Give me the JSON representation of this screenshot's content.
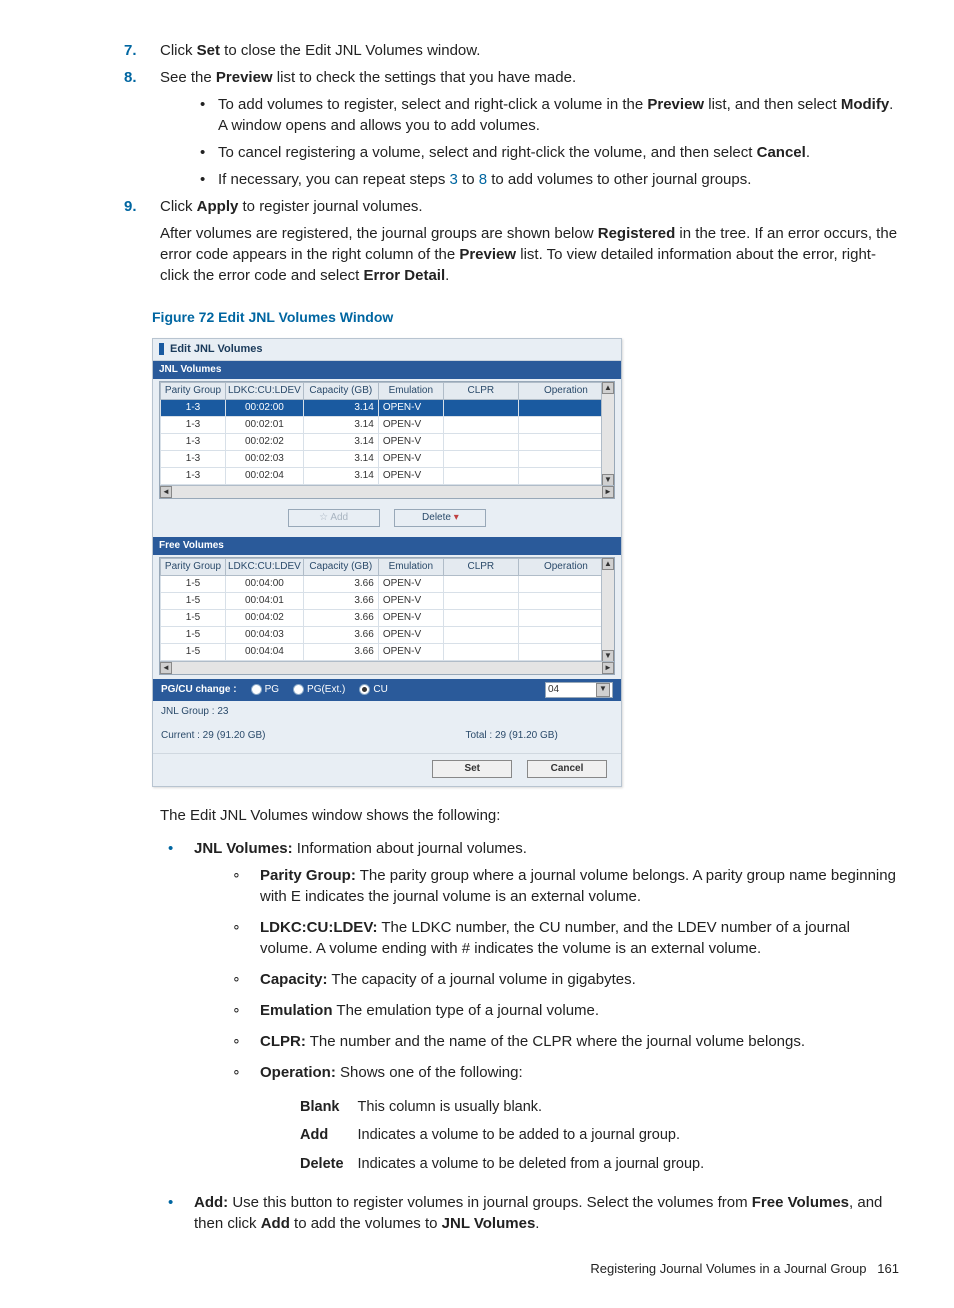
{
  "steps": {
    "s7_num": "7.",
    "s7_a": "Click ",
    "s7_b": "Set",
    "s7_c": " to close the Edit JNL Volumes window.",
    "s8_num": "8.",
    "s8_a": "See the ",
    "s8_b": "Preview",
    "s8_c": " list to check the settings that you have made.",
    "s8_b1_a": "To add volumes to register, select and right-click a volume in the ",
    "s8_b1_b": "Preview",
    "s8_b1_c": " list, and then select ",
    "s8_b1_d": "Modify",
    "s8_b1_e": ". A window opens and allows you to add volumes.",
    "s8_b2_a": "To cancel registering a volume, select and right-click the volume, and then select ",
    "s8_b2_b": "Cancel",
    "s8_b2_c": ".",
    "s8_b3_a": "If necessary, you can repeat steps ",
    "s8_b3_n1": "3",
    "s8_b3_b": " to ",
    "s8_b3_n2": "8",
    "s8_b3_c": " to add volumes to other journal groups.",
    "s9_num": "9.",
    "s9_a": "Click ",
    "s9_b": "Apply",
    "s9_c": " to register journal volumes.",
    "s9_p_a": "After volumes are registered, the journal groups are shown below ",
    "s9_p_b": "Registered",
    "s9_p_c": " in the tree. If an error occurs, the error code appears in the right column of the ",
    "s9_p_d": "Preview",
    "s9_p_e": " list. To view detailed information about the error, right-click the error code and select ",
    "s9_p_f": "Error Detail",
    "s9_p_g": "."
  },
  "figure_caption": "Figure 72 Edit JNL Volumes Window",
  "win": {
    "title": "Edit JNL Volumes",
    "sec_jnl": "JNL Volumes",
    "sec_free": "Free Volumes",
    "headers": [
      "Parity Group",
      "LDKC:CU:LDEV",
      "Capacity (GB)",
      "Emulation",
      "CLPR",
      "Operation"
    ],
    "jnl_rows": [
      {
        "pg": "1-3",
        "ldev": "00:02:00",
        "cap": "3.14",
        "emu": "OPEN-V",
        "clpr": "",
        "op": ""
      },
      {
        "pg": "1-3",
        "ldev": "00:02:01",
        "cap": "3.14",
        "emu": "OPEN-V",
        "clpr": "",
        "op": ""
      },
      {
        "pg": "1-3",
        "ldev": "00:02:02",
        "cap": "3.14",
        "emu": "OPEN-V",
        "clpr": "",
        "op": ""
      },
      {
        "pg": "1-3",
        "ldev": "00:02:03",
        "cap": "3.14",
        "emu": "OPEN-V",
        "clpr": "",
        "op": ""
      },
      {
        "pg": "1-3",
        "ldev": "00:02:04",
        "cap": "3.14",
        "emu": "OPEN-V",
        "clpr": "",
        "op": ""
      }
    ],
    "free_rows": [
      {
        "pg": "1-5",
        "ldev": "00:04:00",
        "cap": "3.66",
        "emu": "OPEN-V",
        "clpr": "",
        "op": ""
      },
      {
        "pg": "1-5",
        "ldev": "00:04:01",
        "cap": "3.66",
        "emu": "OPEN-V",
        "clpr": "",
        "op": ""
      },
      {
        "pg": "1-5",
        "ldev": "00:04:02",
        "cap": "3.66",
        "emu": "OPEN-V",
        "clpr": "",
        "op": ""
      },
      {
        "pg": "1-5",
        "ldev": "00:04:03",
        "cap": "3.66",
        "emu": "OPEN-V",
        "clpr": "",
        "op": ""
      },
      {
        "pg": "1-5",
        "ldev": "00:04:04",
        "cap": "3.66",
        "emu": "OPEN-V",
        "clpr": "",
        "op": ""
      }
    ],
    "btn_add": "Add",
    "btn_delete": "Delete",
    "pgcu_label": "PG/CU change :",
    "radio_pg": "PG",
    "radio_pgext": "PG(Ext.)",
    "radio_cu": "CU",
    "combo_val": "04",
    "jnl_group": "JNL Group : 23",
    "current": "Current : 29 (91.20 GB)",
    "total": "Total : 29 (91.20 GB)",
    "btn_set": "Set",
    "btn_cancel": "Cancel"
  },
  "after_fig": "The Edit JNL Volumes window shows the following:",
  "jnl_item": {
    "a": "JNL Volumes:",
    "b": " Information about journal volumes."
  },
  "sub_parity": {
    "a": "Parity Group:",
    "b": " The parity group where a journal volume belongs. A parity group name beginning with E indicates the journal volume is an external volume."
  },
  "sub_ldkc": {
    "a": "LDKC:CU:LDEV:",
    "b": " The LDKC number, the CU number, and the LDEV number of a journal volume. A volume ending with # indicates the volume is an external volume."
  },
  "sub_cap": {
    "a": "Capacity:",
    "b": " The capacity of a journal volume in gigabytes."
  },
  "sub_emu": {
    "a": "Emulation",
    "b": " The emulation type of a journal volume."
  },
  "sub_clpr": {
    "a": "CLPR:",
    "b": " The number and the name of the CLPR where the journal volume belongs."
  },
  "sub_op": {
    "a": "Operation:",
    "b": " Shows one of the following:"
  },
  "op_rows": [
    {
      "k": "Blank",
      "v": "This column is usually blank."
    },
    {
      "k": "Add",
      "v": "Indicates a volume to be added to a journal group."
    },
    {
      "k": "Delete",
      "v": "Indicates a volume to be deleted from a journal group."
    }
  ],
  "add_item": {
    "a": "Add:",
    "b": " Use this button to register volumes in journal groups. Select the volumes from ",
    "c": "Free Volumes",
    "d": ", and then click ",
    "e": "Add",
    "f": " to add the volumes to ",
    "g": "JNL Volumes",
    "h": "."
  },
  "footer_text": "Registering Journal Volumes in a Journal Group",
  "footer_page": "161"
}
